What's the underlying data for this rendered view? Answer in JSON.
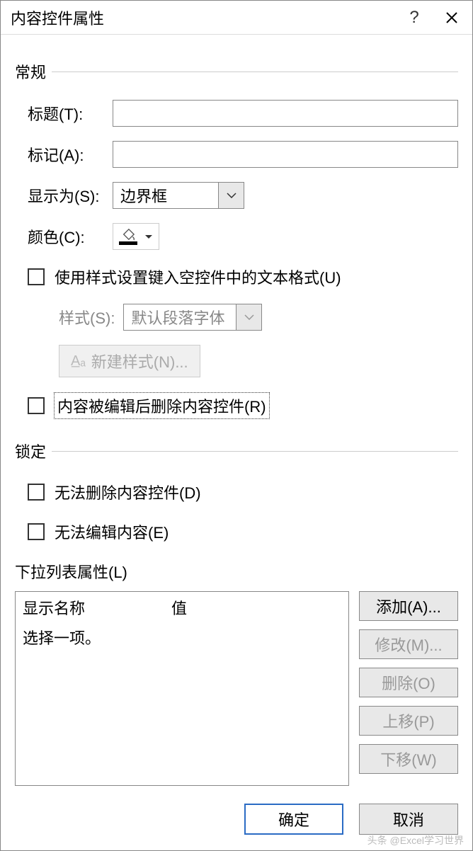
{
  "title": "内容控件属性",
  "groups": {
    "general": "常规",
    "lock": "锁定"
  },
  "labels": {
    "title_field": "标题(T):",
    "tag_field": "标记(A):",
    "show_as": "显示为(S):",
    "color": "颜色(C):",
    "style": "样式(S):",
    "dropdown_props": "下拉列表属性(L)"
  },
  "values": {
    "title_input": "",
    "tag_input": "",
    "show_as_selected": "边界框",
    "style_selected": "默认段落字体"
  },
  "checkboxes": {
    "use_style": "使用样式设置键入空控件中的文本格式(U)",
    "remove_after_edit": "内容被编辑后删除内容控件(R)",
    "cannot_delete": "无法删除内容控件(D)",
    "cannot_edit": "无法编辑内容(E)"
  },
  "buttons": {
    "new_style": "新建样式(N)...",
    "add": "添加(A)...",
    "modify": "修改(M)...",
    "delete": "删除(O)",
    "move_up": "上移(P)",
    "move_down": "下移(W)",
    "ok": "确定",
    "cancel": "取消"
  },
  "list": {
    "col1": "显示名称",
    "col2": "值",
    "rows": [
      {
        "name": "选择一项。",
        "value": ""
      }
    ]
  },
  "watermark": "头条 @Excel学习世界"
}
